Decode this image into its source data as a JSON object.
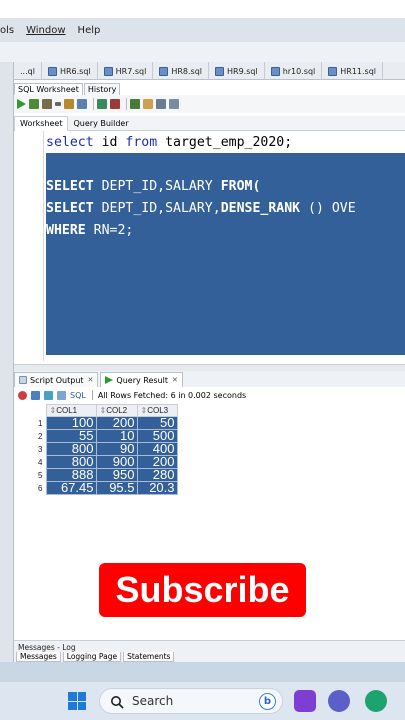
{
  "menu": {
    "items": [
      "ols",
      "Window",
      "Help"
    ]
  },
  "file_tabs": [
    {
      "label": "...ql"
    },
    {
      "label": "HR6.sql"
    },
    {
      "label": "HR7.sql"
    },
    {
      "label": "HR8.sql"
    },
    {
      "label": "HR9.sql"
    },
    {
      "label": "hr10.sql"
    },
    {
      "label": "HR11.sql"
    }
  ],
  "sub_tabs": {
    "worksheet": "SQL Worksheet",
    "history": "History"
  },
  "worksheet_tabs": {
    "worksheet": "Worksheet",
    "query_builder": "Query Builder"
  },
  "editor": {
    "line1_kw1": "select",
    "line1_rest": " id ",
    "line1_kw2": "from",
    "line1_tail": " target_emp_2020;",
    "line3_a": "SELECT",
    "line3_b": " DEPT_ID,SALARY ",
    "line3_c": "FROM(",
    "line4_a": "SELECT",
    "line4_b": " DEPT_ID,SALARY,",
    "line4_c": "DENSE_RANK",
    "line4_d": " () OVE",
    "line5_a": "WHERE",
    "line5_b": " RN=2;"
  },
  "output_tabs": {
    "script_output": "Script Output",
    "query_result": "Query Result"
  },
  "result": {
    "sql_label": "SQL",
    "status": "All Rows Fetched: 6 in 0.002 seconds",
    "columns": [
      "COL1",
      "COL2",
      "COL3"
    ],
    "rows": [
      {
        "n": "1",
        "c1": "100",
        "c2": "200",
        "c3": "50"
      },
      {
        "n": "2",
        "c1": "55",
        "c2": "10",
        "c3": "500"
      },
      {
        "n": "3",
        "c1": "800",
        "c2": "90",
        "c3": "400"
      },
      {
        "n": "4",
        "c1": "800",
        "c2": "900",
        "c3": "200"
      },
      {
        "n": "5",
        "c1": "888",
        "c2": "950",
        "c3": "280"
      },
      {
        "n": "6",
        "c1": "67.45",
        "c2": "95.5",
        "c3": "20.3"
      }
    ]
  },
  "messages": {
    "title": "Messages - Log",
    "tabs": [
      "Messages",
      "Logging Page",
      "Statements"
    ]
  },
  "overlay": {
    "subscribe": "Subscribe"
  },
  "taskbar": {
    "search_placeholder": "Search",
    "bing_label": "b"
  },
  "colors": {
    "selection": "#34609a",
    "keyword": "#1a2fb5",
    "subscribe": "#ff0000"
  }
}
